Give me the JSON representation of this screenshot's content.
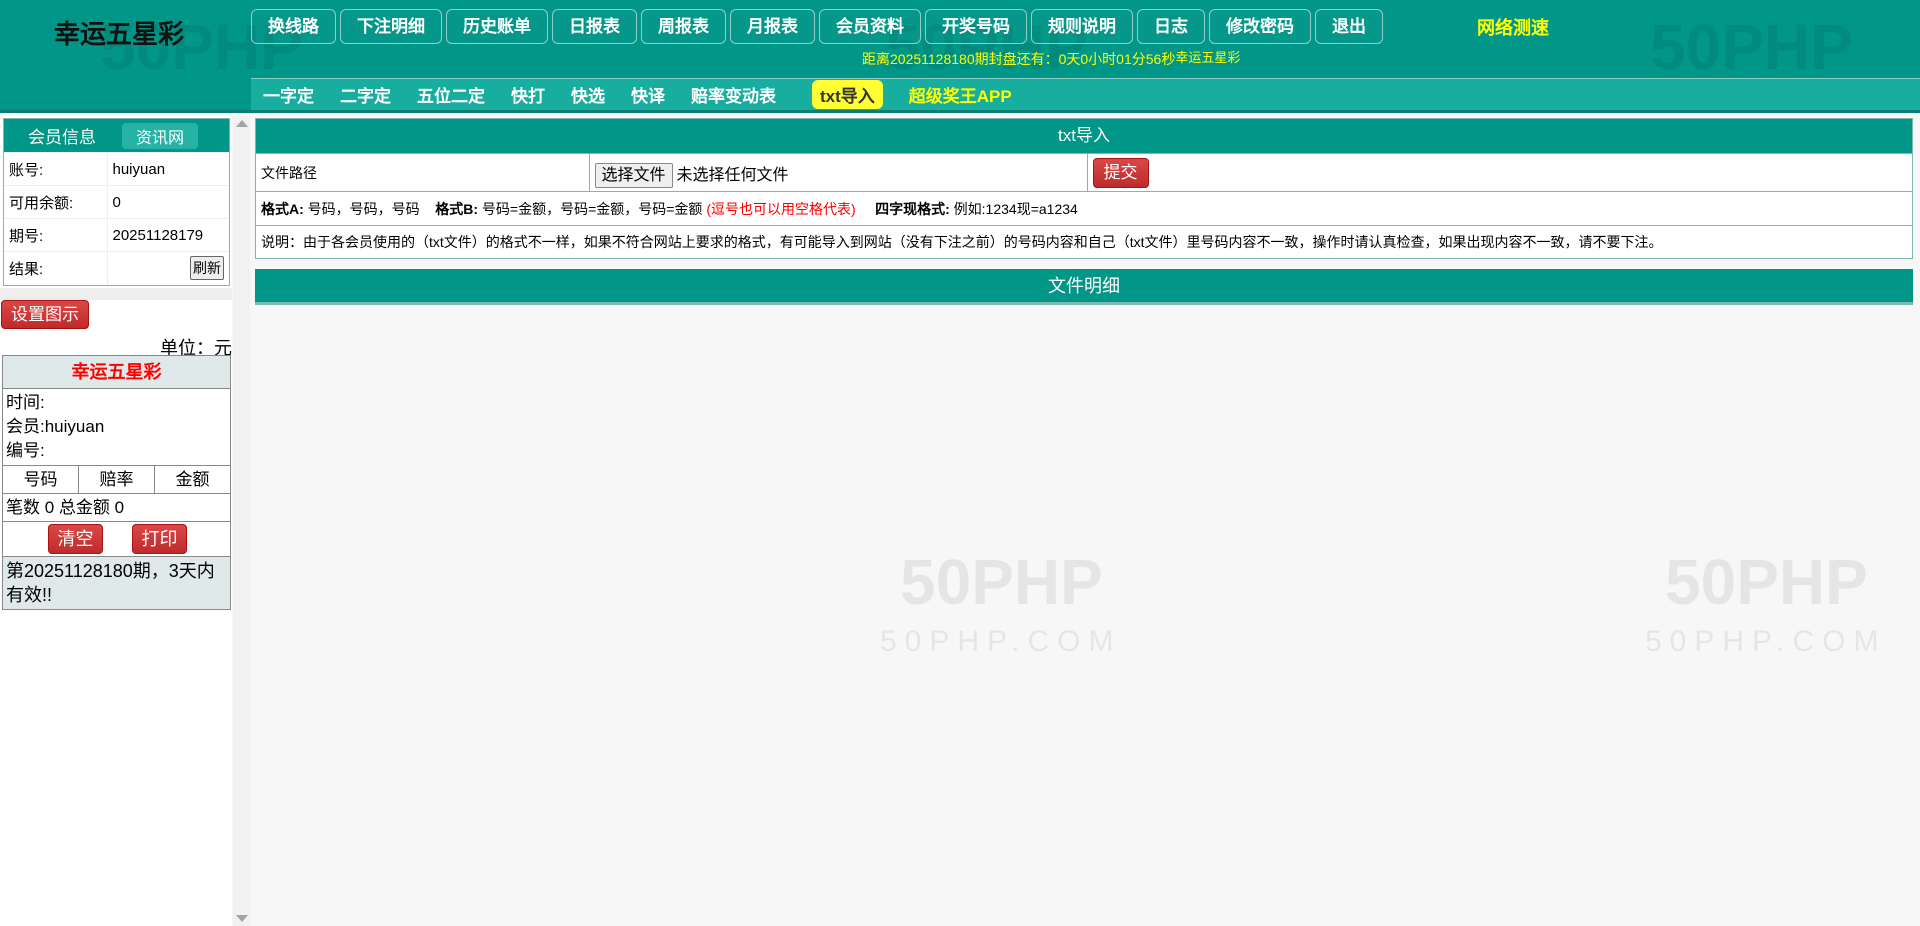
{
  "header": {
    "logo": "幸运五星彩",
    "nav": [
      "换线路",
      "下注明细",
      "历史账单",
      "日报表",
      "周报表",
      "月报表",
      "会员资料",
      "开奖号码",
      "规则说明",
      "日志",
      "修改密码",
      "退出"
    ],
    "speed_test": "网络测速",
    "countdown": "距离20251128180期封盘还有：0天0小时01分56秒",
    "countdown_game": "幸运五星彩",
    "subnav": [
      "一字定",
      "二字定",
      "五位二定",
      "快打",
      "快选",
      "快译",
      "赔率变动表"
    ],
    "subnav_active": "txt导入",
    "subnav_app": "超级奖王APP"
  },
  "watermark": {
    "big": "50PHP",
    "small": "50PHP.COM"
  },
  "sidebar": {
    "info_title": "会员信息",
    "info_link": "资讯网",
    "rows": [
      {
        "k": "账号:",
        "v": "huiyuan"
      },
      {
        "k": "可用余额:",
        "v": "0"
      },
      {
        "k": "期号:",
        "v": "20251128179"
      },
      {
        "k": "结果:",
        "v": ""
      }
    ],
    "refresh": "刷新",
    "set_icon": "设置图示",
    "unit": "单位：元",
    "ticket": {
      "title": "幸运五星彩",
      "time": "时间:",
      "member": "会员:huiyuan",
      "serial": "编号:",
      "cols": [
        "号码",
        "赔率",
        "金额"
      ],
      "summary": "笔数 0 总金额 0",
      "clear": "清空",
      "print": "打印",
      "valid": "第20251128180期，3天内有效!!"
    }
  },
  "main": {
    "title": "txt导入",
    "file_label": "文件路径",
    "choose_file": "选择文件",
    "no_file": "未选择任何文件",
    "submit": "提交",
    "fmtA_label": "格式A:",
    "fmtA": "号码，号码，号码",
    "fmtB_label": "格式B:",
    "fmtB": "号码=金额，号码=金额，号码=金额",
    "fmt_note": "(逗号也可以用空格代表)",
    "fmt4_label": "四字现格式:",
    "fmt4": "例如:1234现=a1234",
    "desc": "说明：由于各会员使用的（txt文件）的格式不一样，如果不符合网站上要求的格式，有可能导入到网站（没有下注之前）的号码内容和自己（txt文件）里号码内容不一致，操作时请认真检查，如果出现内容不一致，请不要下注。",
    "detail_title": "文件明细"
  },
  "colors": {
    "teal": "#009688",
    "yellow": "#ffff00",
    "red": "#ff0000"
  }
}
